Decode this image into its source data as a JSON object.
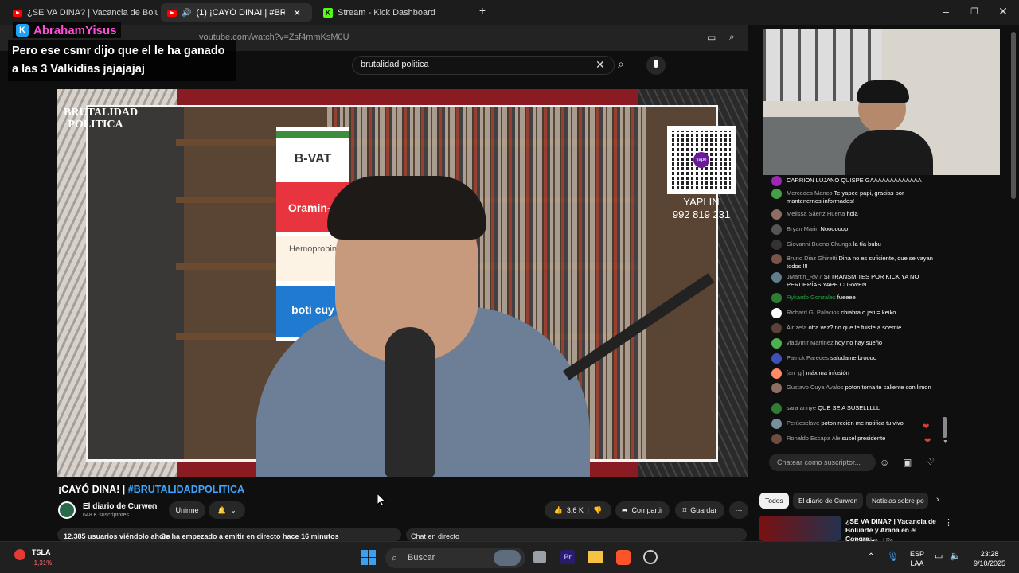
{
  "browser": {
    "tabs": [
      {
        "label": "¿SE VA DINA? | Vacancia de Boluarte",
        "active": false
      },
      {
        "label": "(1) ¡CAYÓ DINA! | #BRUTALID",
        "active": true
      },
      {
        "label": "Stream - Kick Dashboard",
        "active": false
      }
    ],
    "url": "youtube.com/watch?v=Zsf4mmKsM0U"
  },
  "overlay": {
    "streamer_name": "AbrahamYisus",
    "message": "Pero ese csmr dijo que el le ha ganado a las 3 Valkidias jajajajaj"
  },
  "youtube": {
    "search_query": "brutalidad politica",
    "video": {
      "logo_text": "BRUTALIDAD POLITICA",
      "sponsors": [
        "B-VAT",
        "Oramin-F",
        "Hemopropin",
        "boti cuy"
      ],
      "qr_label": "yape",
      "yape_name": "YAPLIN",
      "yape_number": "992 819 231"
    },
    "title_plain": "¡CAYÓ DINA! | ",
    "title_hashtag": "#BRUTALIDADPOLITICA",
    "channel_name": "El diario de Curwen",
    "subscribers": "648 K suscriptores",
    "join_label": "Unirme",
    "likes": "3,6 K",
    "share_label": "Compartir",
    "save_label": "Guardar",
    "viewers": "12.385 usuarios viéndolo ahora",
    "started": "Se ha empezado a emitir en directo hace 16 minutos",
    "live_chat_label": "Chat en directo"
  },
  "chat": {
    "messages": [
      {
        "name": "",
        "text": "CARRION LUJANO QUISPE GAAAAAAAAAAAAA",
        "color": "#9c27b0"
      },
      {
        "name": "Mercedes Manco",
        "text": "Te yapee papi, gracias por mantenernos informados!",
        "color": "#43a047"
      },
      {
        "name": "Melissa Sáenz Huerta",
        "text": "hola",
        "color": "#8d6e63"
      },
      {
        "name": "Bryan Marin",
        "text": "Noooooop",
        "color": "#555555"
      },
      {
        "name": "Giovanni Bueno Chunga",
        "text": "la tía bubu",
        "color": "#333333"
      },
      {
        "name": "Bruno Diaz Ghiretti",
        "text": "Dina no es suficiente, que se vayan todos!!!!",
        "color": "#795548"
      },
      {
        "name": "JMartin_RM7",
        "text": "SI TRANSMITES POR KICK YA NO PERDERÍAS YAPE CURWEN",
        "color": "#607d8b"
      },
      {
        "name": "Rykardo Gonzales",
        "text": "fueeee",
        "color": "#2e7d32"
      },
      {
        "name": "Richard G. Palacios",
        "text": "chiabra o jeri = keiko",
        "color": "#ffffff"
      },
      {
        "name": "Air zeta",
        "text": "otra vez? no que te fuiste a soemie",
        "color": "#5d4037"
      },
      {
        "name": "vladymir Martinez",
        "text": "hoy no hay sueño",
        "color": "#4caf50"
      },
      {
        "name": "Patrick Paredes",
        "text": "saludame broooo",
        "color": "#3f51b5"
      },
      {
        "name": "[an_gi]",
        "text": "máxima infusión",
        "color": "#ff8a65"
      },
      {
        "name": "Gustavo Cuya Avalos",
        "text": "poton toma te caliente con limon",
        "color": "#8d6e63"
      },
      {
        "name": "sara annye",
        "text": "QUE SE A SUSELLLLL",
        "color": "#2e7d32"
      },
      {
        "name": "Perúesclave",
        "text": "poton recién me notifica tu vivo",
        "color": "#78909c"
      },
      {
        "name": "Ronaldo Escapa Ale",
        "text": "susel presidente",
        "color": "#6d4c41"
      }
    ],
    "input_placeholder": "Chatear como suscriptor..."
  },
  "related": {
    "chips": [
      "Todos",
      "El diario de Curwen",
      "Noticias sobre po"
    ],
    "first_title": "¿SE VA DINA? | Vacancia de Boluarte y Arana en el Congre...",
    "first_channel": "La República - LRa"
  },
  "taskbar": {
    "ticker": "TSLA",
    "ticker_change": "-1,31%",
    "search_label": "Buscar",
    "language": "ESP",
    "language_sub": "LAA",
    "time": "23:28",
    "date": "9/10/2025"
  }
}
